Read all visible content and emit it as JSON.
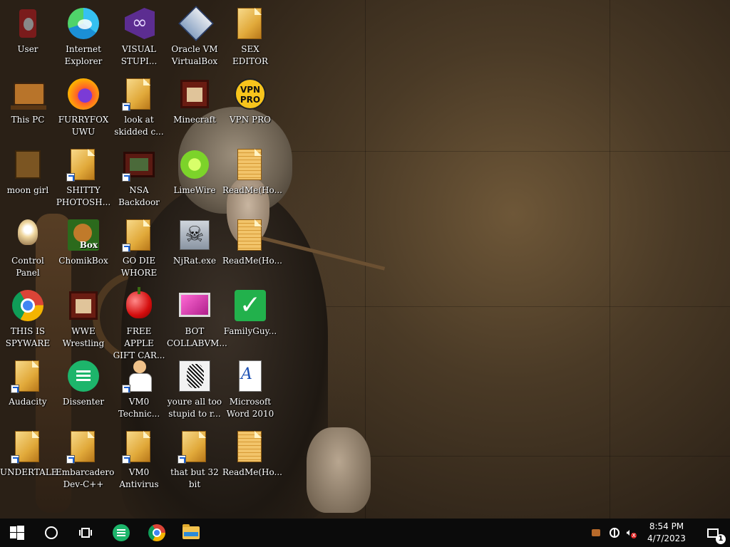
{
  "desktop_icons": [
    {
      "label": "User",
      "icon": "user-folder-icon"
    },
    {
      "label": "Internet\nExplorer",
      "icon": "edge-icon"
    },
    {
      "label": "VISUAL\nSTUPI...",
      "icon": "visual-studio-icon"
    },
    {
      "label": "Oracle VM\nVirtualBox",
      "icon": "virtualbox-icon"
    },
    {
      "label": "SEX\nEDITOR",
      "icon": "document-icon"
    },
    {
      "label": "This PC",
      "icon": "computer-icon"
    },
    {
      "label": "FURRYFOX\nUWU",
      "icon": "firefox-icon"
    },
    {
      "label": "look at\nskidded c...",
      "icon": "document-icon"
    },
    {
      "label": "Minecraft",
      "icon": "minecraft-icon"
    },
    {
      "label": "VPN PRO",
      "icon": "vpn-pro-icon",
      "badge_text": "VPN\nPRO"
    },
    {
      "label": "moon girl",
      "icon": "box-icon"
    },
    {
      "label": "SHITTY\nPHOTOSH...",
      "icon": "document-icon"
    },
    {
      "label": "NSA\nBackdoor",
      "icon": "nsa-backdoor-icon"
    },
    {
      "label": "LimeWire",
      "icon": "limewire-icon"
    },
    {
      "label": "ReadMe(Ho...",
      "icon": "readme-document-icon"
    },
    {
      "label": "Control Panel",
      "icon": "lamp-icon"
    },
    {
      "label": "ChomikBox",
      "icon": "chomikbox-icon"
    },
    {
      "label": "GO DIE\nWHORE",
      "icon": "document-icon"
    },
    {
      "label": "NjRat.exe",
      "icon": "skull-icon"
    },
    {
      "label": "ReadMe(Ho...",
      "icon": "readme-document-icon"
    },
    {
      "label": "THIS IS\nSPYWARE",
      "icon": "chrome-icon"
    },
    {
      "label": "WWE\nWrestling",
      "icon": "minecraft-icon"
    },
    {
      "label": "FREE APPLE\nGIFT CAR...",
      "icon": "apple-icon"
    },
    {
      "label": "BOT\nCOLLABVM...",
      "icon": "monitor-icon"
    },
    {
      "label": "FamilyGuy...",
      "icon": "checkmark-icon"
    },
    {
      "label": "Audacity",
      "icon": "document-icon"
    },
    {
      "label": "Dissenter",
      "icon": "dissenter-icon"
    },
    {
      "label": "VM0\nTechnic...",
      "icon": "technician-icon"
    },
    {
      "label": "youre all too\nstupid to r...",
      "icon": "portrait-icon"
    },
    {
      "label": "Microsoft\nWord 2010",
      "icon": "word-document-icon"
    },
    {
      "label": "UNDERTALE",
      "icon": "document-icon"
    },
    {
      "label": "Embarcadero\nDev-C++",
      "icon": "document-icon"
    },
    {
      "label": "VM0\nAntivirus",
      "icon": "document-icon"
    },
    {
      "label": "that but 32\nbit",
      "icon": "document-icon"
    },
    {
      "label": "ReadMe(Ho...",
      "icon": "readme-document-icon"
    }
  ],
  "taskbar": {
    "pinned": [
      "start-icon",
      "search-circle-icon",
      "task-view-icon",
      "dissenter-icon",
      "chrome-icon",
      "file-explorer-icon"
    ],
    "clock_time": "8:54 PM",
    "clock_date": "4/7/2023",
    "notification_count": "1",
    "volume_muted": "x"
  },
  "colors": {
    "taskbar_bg": "#0b0b0b",
    "wallpaper_tone": "#5b4630",
    "start_blue": "#ffffff"
  }
}
